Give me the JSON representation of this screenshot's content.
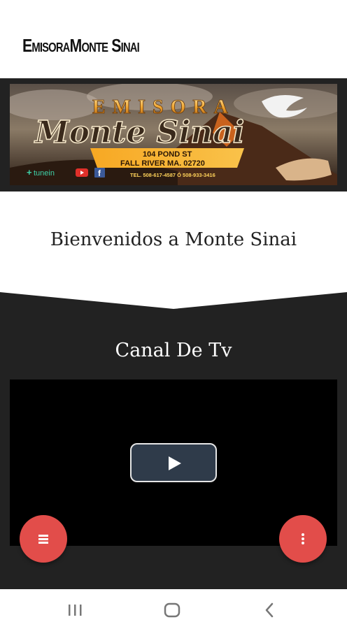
{
  "header": {
    "title": "EmisoraMonte Sinai"
  },
  "banner": {
    "logo_line1": "EMISORA",
    "logo_line2": "Monte Sinai",
    "address_line1": "104 POND ST",
    "address_line2": "FALL RIVER MA. 02720",
    "phone": "TEL. 508-617-4587 Ó 508-933-3416",
    "social": {
      "tunein": "tunein",
      "youtube": "YouTube",
      "facebook": "f"
    }
  },
  "welcome": {
    "text": "Bienvenidos a Monte Sinai"
  },
  "tv_section": {
    "title": "Canal De Tv"
  },
  "colors": {
    "dark_bg": "#222222",
    "fab": "#e24d4a",
    "play_button": "#2f3b4a"
  },
  "icons": {
    "fab_left": "menu-icon",
    "fab_right": "more-vert-icon",
    "play": "play-icon",
    "nav": [
      "recents-icon",
      "home-icon",
      "back-icon"
    ]
  }
}
